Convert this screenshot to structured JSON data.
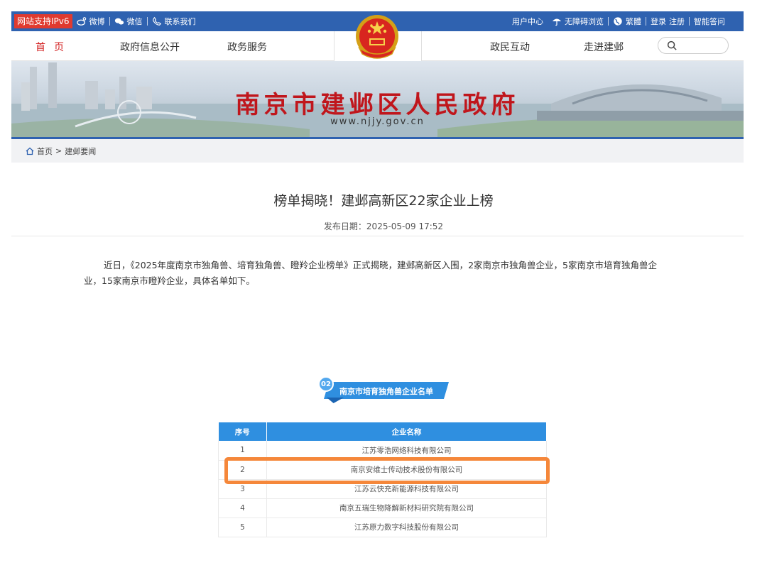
{
  "topbar": {
    "ipv6": "网站支持IPv6",
    "weibo": "微博",
    "wechat": "微信",
    "contact": "联系我们",
    "user_center": "用户中心",
    "accessible": "无障碍浏览",
    "traditional": "繁體",
    "login": "登录",
    "register": "注册",
    "smart_qa": "智能答问"
  },
  "nav": {
    "home": "首页",
    "gov_info": "政府信息公开",
    "services": "政务服务",
    "interaction": "政民互动",
    "about": "走进建邺"
  },
  "banner": {
    "title": "南京市建邺区人民政府",
    "url": "www.njjy.gov.cn"
  },
  "breadcrumb": {
    "home": "首页",
    "sep": ">",
    "current": "建邺要闻"
  },
  "article": {
    "title": "榜单揭晓！建邺高新区22家企业上榜",
    "date": "发布日期：2025-05-09 17:52",
    "paragraph": "近日，《2025年度南京市独角兽、培育独角兽、瞪羚企业榜单》正式揭晓，建邺高新区入围，2家南京市独角兽企业，5家南京市培育独角兽企业，15家南京市瞪羚企业，具体名单如下。"
  },
  "section": {
    "number": "02",
    "title": "南京市培育独角兽企业名单"
  },
  "table": {
    "headers": [
      "序号",
      "企业名称"
    ],
    "rows": [
      [
        "1",
        "江苏零浩网络科技有限公司"
      ],
      [
        "2",
        "南京安维士传动技术股份有限公司"
      ],
      [
        "3",
        "江苏云快充新能源科技有限公司"
      ],
      [
        "4",
        "南京五瑞生物降解新材料研究院有限公司"
      ],
      [
        "5",
        "江苏原力数字科技股份有限公司"
      ]
    ]
  },
  "colors": {
    "primary_blue": "#2f62b0",
    "table_blue": "#2f8fe0",
    "title_red": "#c0161c",
    "highlight_orange": "#f5873a"
  }
}
